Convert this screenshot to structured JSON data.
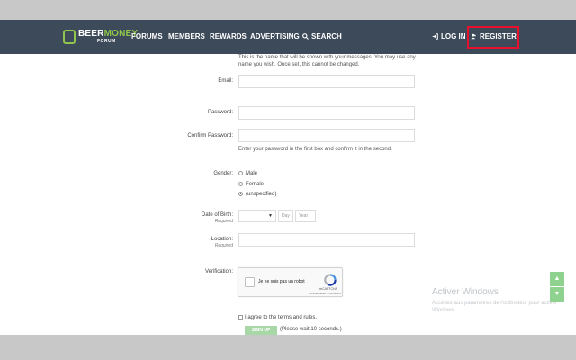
{
  "brand": {
    "logo_top_1": "BEER",
    "logo_top_2": "MONEY",
    "logo_sub": "FORUM",
    "accent": "#8fc54a",
    "nav_bg": "#3d4a5a"
  },
  "nav": {
    "forums": "FORUMS",
    "members": "MEMBERS",
    "rewards": "REWARDS",
    "advertising": "ADVERTISING",
    "search": "SEARCH",
    "login": "LOG IN",
    "register": "REGISTER"
  },
  "form": {
    "name_hint_line1": "This is the name that will be shown with your messages. You may use any",
    "name_hint_line2": "name you wish. Once set, this cannot be changed.",
    "email_label": "Email:",
    "password_label": "Password:",
    "confirm_password_label": "Confirm Password:",
    "password_hint": "Enter your password in the first box and confirm it in the second.",
    "gender_label": "Gender:",
    "gender_options": [
      "Male",
      "Female",
      "(unspecified)"
    ],
    "gender_selected": "(unspecified)",
    "dob_label": "Date of Birth:",
    "dob_required": "Required",
    "dob_day_placeholder": "Day",
    "dob_year_placeholder": "Year",
    "location_label": "Location:",
    "location_required": "Required",
    "verification_label": "Verification:",
    "recaptcha_text": "Je ne suis pas un robot",
    "recaptcha_brand": "reCAPTCHA",
    "recaptcha_links": "Confidentialité - Conditions",
    "agree_text": "I agree to the terms and rules.",
    "signup_label": "SIGN UP",
    "wait_text": "(Please wait 10 seconds.)"
  },
  "watermark": {
    "title": "Activer Windows",
    "text": "Accédez aux paramètres de l'ordinateur pour activer Windows."
  }
}
